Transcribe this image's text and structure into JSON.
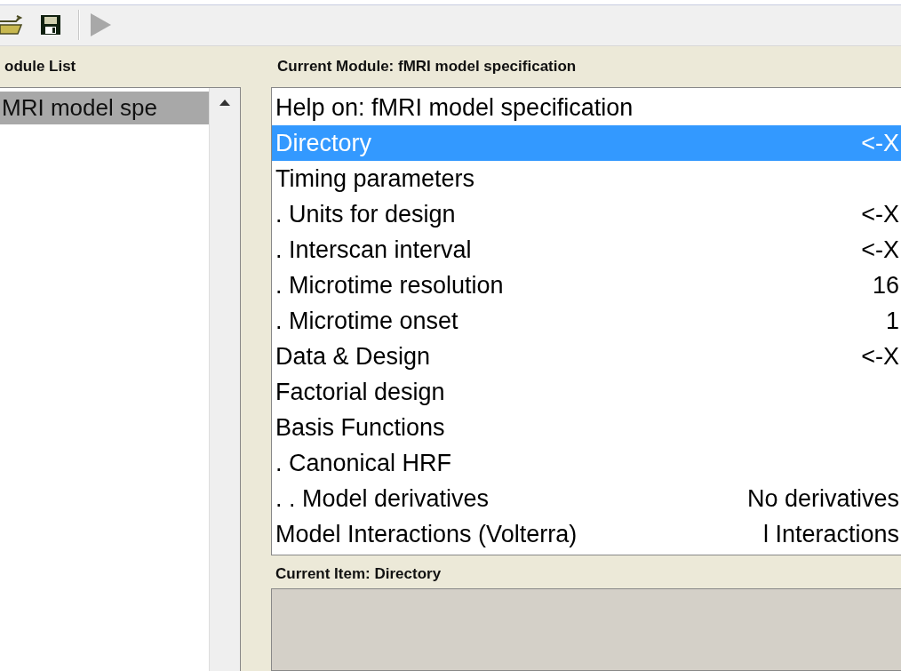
{
  "toolbar": {
    "run_disabled": true
  },
  "module_list": {
    "title": "odule List",
    "items": [
      {
        "label": "MRI model spe",
        "selected": true
      }
    ]
  },
  "current_module": {
    "title": "Current Module: fMRI model specification",
    "items": [
      {
        "label": "Help on: fMRI model specification",
        "value": "",
        "selected": false
      },
      {
        "label": "Directory",
        "value": "<-X",
        "selected": true
      },
      {
        "label": "Timing parameters",
        "value": "",
        "selected": false
      },
      {
        "label": ". Units for design",
        "value": "<-X",
        "selected": false
      },
      {
        "label": ". Interscan interval",
        "value": "<-X",
        "selected": false
      },
      {
        "label": ". Microtime resolution",
        "value": "16",
        "selected": false
      },
      {
        "label": ". Microtime onset",
        "value": "1",
        "selected": false
      },
      {
        "label": "Data & Design",
        "value": "<-X",
        "selected": false
      },
      {
        "label": "Factorial design",
        "value": "",
        "selected": false
      },
      {
        "label": "Basis Functions",
        "value": "",
        "selected": false
      },
      {
        "label": ". Canonical HRF",
        "value": "",
        "selected": false
      },
      {
        "label": ". . Model derivatives",
        "value": "No derivatives",
        "selected": false
      },
      {
        "label": "Model Interactions (Volterra)",
        "value": "l Interactions",
        "selected": false
      }
    ]
  },
  "current_item": {
    "title": "Current Item: Directory"
  }
}
